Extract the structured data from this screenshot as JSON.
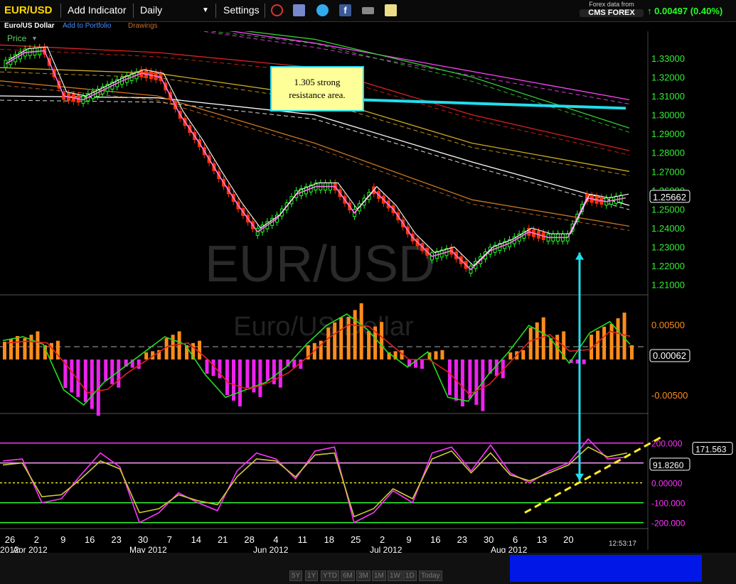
{
  "toolbar": {
    "symbol": "EUR/USD",
    "add_indicator": "Add Indicator",
    "interval": "Daily",
    "settings": "Settings",
    "forex_line1": "Forex data from",
    "forex_line2": "CMS FOREX",
    "change_quote": "0.00497 (0.40%)",
    "colors": {
      "symbol": "#ffd700",
      "up": "#22ee22"
    }
  },
  "subbar": {
    "name": "Euro/US Dollar",
    "add_portfolio": "Add to Portfolio",
    "drawings": "Drawings",
    "price_label": "Price"
  },
  "timestamp": "12:53:17",
  "range_buttons": [
    "5Y",
    "1Y",
    "YTD",
    "6M",
    "3M",
    "1M",
    "1W",
    "1D",
    "Today"
  ],
  "chart_data": [
    {
      "type": "line",
      "panel": "price",
      "watermark": "EUR/USD",
      "ylim": [
        1.2,
        1.34
      ],
      "y_ticks": [
        "1.33000",
        "1.32000",
        "1.31000",
        "1.30000",
        "1.29000",
        "1.28000",
        "1.27000",
        "1.26000",
        "1.25000",
        "1.24000",
        "1.23000",
        "1.22000",
        "1.21000"
      ],
      "last_price_label": "1.25662",
      "annotation": {
        "text_line1": "1.305 strong",
        "text_line2": "resistance area.",
        "target_value": 1.3035
      },
      "x_tick_labels": [
        "26",
        "2",
        "9",
        "16",
        "23",
        "30",
        "7",
        "14",
        "21",
        "28",
        "4",
        "11",
        "18",
        "25",
        "2",
        "9",
        "16",
        "23",
        "30",
        "6",
        "13",
        "20"
      ],
      "month_labels": [
        "2012",
        "Apr 2012",
        "May 2012",
        "Jun 2012",
        "Jul 2012",
        "Aug 2012"
      ],
      "series": [
        {
          "values": [
            1.327,
            1.333,
            1.334,
            1.31,
            1.308,
            1.313,
            1.318,
            1.322,
            1.32,
            1.3,
            1.285,
            1.268,
            1.252,
            1.238,
            1.245,
            1.258,
            1.262,
            1.262,
            1.248,
            1.26,
            1.25,
            1.235,
            1.225,
            1.228,
            1.218,
            1.228,
            1.232,
            1.238,
            1.235,
            1.235,
            1.256,
            1.254,
            1.256
          ],
          "color": "#ff6fe0"
        }
      ],
      "moving_averages": [
        {
          "color": "#ff44ff",
          "values": [
            1.362,
            1.35,
            1.338,
            1.323,
            1.308
          ]
        },
        {
          "color": "#33cc33",
          "values": [
            1.36,
            1.35,
            1.34,
            1.32,
            1.293
          ]
        },
        {
          "color": "#dd2222",
          "values": [
            1.337,
            1.333,
            1.325,
            1.3,
            1.281
          ]
        },
        {
          "color": "#ccaa22",
          "values": [
            1.325,
            1.322,
            1.31,
            1.285,
            1.27
          ]
        },
        {
          "color": "#ffffff",
          "values": [
            1.31,
            1.309,
            1.3,
            1.275,
            1.252
          ]
        },
        {
          "color": "#cc7722",
          "values": [
            1.318,
            1.31,
            1.285,
            1.255,
            1.241
          ]
        }
      ]
    },
    {
      "type": "bar",
      "panel": "macd",
      "watermark": "Euro/US Dollar",
      "y_ticks": [
        "0.00500",
        "-0.00500"
      ],
      "last_value_label": "0.00062",
      "values": [
        0.0025,
        0.003,
        0.002,
        -0.004,
        -0.006,
        -0.003,
        -0.001,
        0.001,
        0.003,
        0.002,
        -0.002,
        -0.005,
        -0.004,
        -0.003,
        -0.001,
        0.002,
        0.0045,
        0.006,
        0.004,
        0.001,
        -0.001,
        0.001,
        -0.005,
        -0.0055,
        -0.002,
        0.001,
        0.0045,
        0.003,
        -0.0005,
        0.0035,
        0.005,
        0.002
      ]
    },
    {
      "type": "line",
      "panel": "cci",
      "ylim": [
        -230,
        270
      ],
      "y_ticks": [
        "200.000",
        "100.000",
        "0.00000",
        "-100.000",
        "-200.000"
      ],
      "last_value_labels": [
        "171.563",
        "91.8260"
      ],
      "series": [
        {
          "color": "#ff33ff",
          "values": [
            110,
            120,
            -100,
            -80,
            40,
            150,
            80,
            -200,
            -150,
            -50,
            -100,
            -140,
            60,
            150,
            120,
            20,
            160,
            180,
            -200,
            -150,
            -40,
            -100,
            150,
            180,
            60,
            190,
            50,
            0,
            60,
            100,
            220,
            120,
            130
          ]
        },
        {
          "color": "#cccc33",
          "values": [
            90,
            100,
            -70,
            -60,
            20,
            110,
            70,
            -150,
            -130,
            -60,
            -90,
            -110,
            30,
            120,
            110,
            30,
            140,
            150,
            -170,
            -130,
            -30,
            -80,
            120,
            160,
            50,
            150,
            40,
            10,
            50,
            90,
            180,
            130,
            150
          ]
        }
      ]
    }
  ]
}
